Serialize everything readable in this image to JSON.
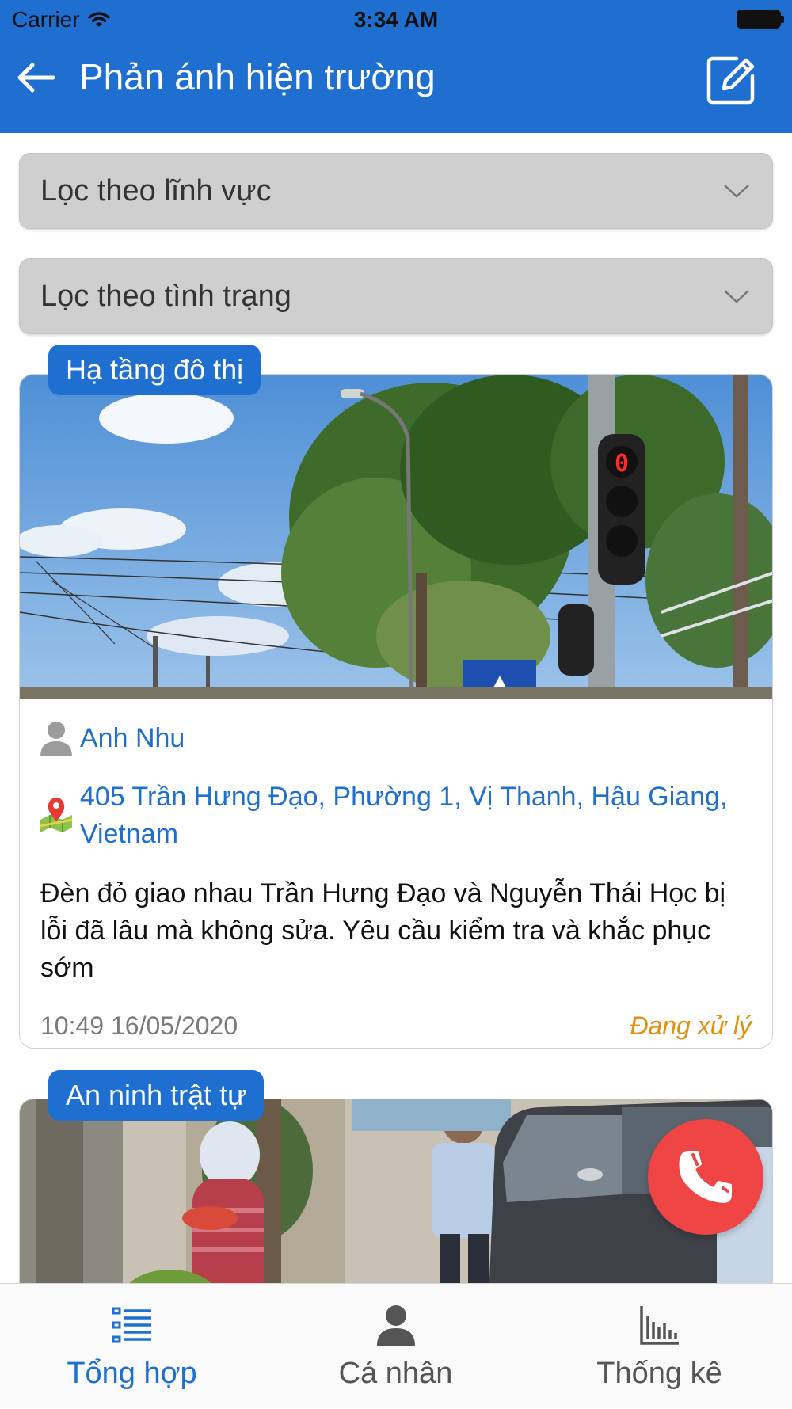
{
  "status_bar": {
    "carrier": "Carrier",
    "time": "3:34 AM"
  },
  "header": {
    "title": "Phản ánh hiện trường",
    "back_icon": "arrow-left-icon",
    "edit_icon": "edit-icon"
  },
  "filters": {
    "field_label": "Lọc theo lĩnh vực",
    "status_label": "Lọc theo tình trạng"
  },
  "reports": [
    {
      "category": "Hạ tầng đô thị",
      "author": "Anh Nhu",
      "address": "405 Trần Hưng Đạo, Phường 1, Vị Thanh, Hậu Giang, Vietnam",
      "description": "Đèn đỏ giao nhau Trần Hưng Đạo và Nguyễn Thái Học bị lỗi đã lâu mà không sửa. Yêu cầu kiểm tra và khắc phục sớm",
      "datetime": "10:49 16/05/2020",
      "status": "Đang xử lý",
      "traffic_light_counter": "0"
    },
    {
      "category": "An ninh trật tự"
    }
  ],
  "tabs": [
    {
      "label": "Tổng hợp",
      "icon": "list-icon"
    },
    {
      "label": "Cá nhân",
      "icon": "person-icon"
    },
    {
      "label": "Thống kê",
      "icon": "bar-chart-icon"
    }
  ],
  "colors": {
    "primary": "#1f6fd1",
    "status_processing": "#e08f0f",
    "call_button": "#f04545"
  }
}
